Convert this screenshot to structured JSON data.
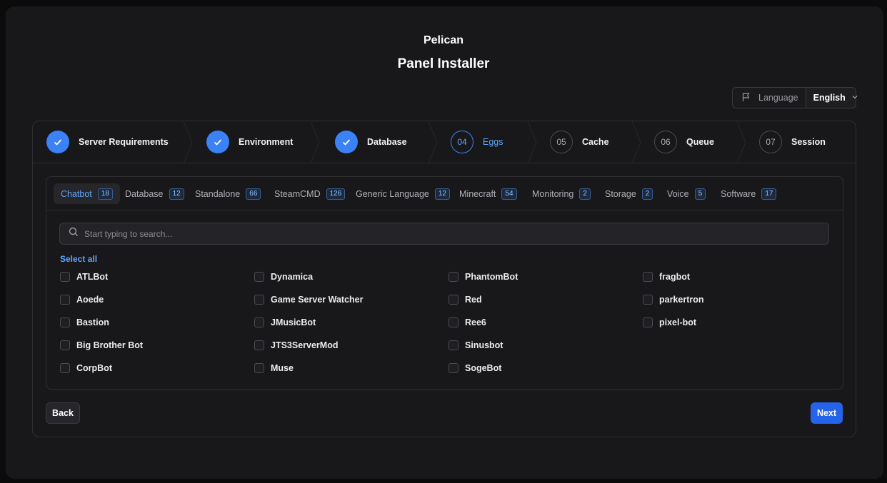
{
  "app": {
    "name": "Pelican",
    "subtitle": "Panel Installer"
  },
  "language": {
    "label": "Language",
    "value": "English"
  },
  "steps": [
    {
      "num": "01",
      "label": "Server Requirements",
      "status": "done"
    },
    {
      "num": "02",
      "label": "Environment",
      "status": "done"
    },
    {
      "num": "03",
      "label": "Database",
      "status": "done"
    },
    {
      "num": "04",
      "label": "Eggs",
      "status": "active"
    },
    {
      "num": "05",
      "label": "Cache",
      "status": "todo"
    },
    {
      "num": "06",
      "label": "Queue",
      "status": "todo"
    },
    {
      "num": "07",
      "label": "Session",
      "status": "todo"
    }
  ],
  "tabs": [
    {
      "label": "Chatbot",
      "count": "18",
      "active": true
    },
    {
      "label": "Database",
      "count": "12"
    },
    {
      "label": "Standalone",
      "count": "66"
    },
    {
      "label": "SteamCMD",
      "count": "126"
    },
    {
      "label": "Generic Language",
      "count": "12"
    },
    {
      "label": "Minecraft",
      "count": "54"
    },
    {
      "label": "Monitoring",
      "count": "2"
    },
    {
      "label": "Storage",
      "count": "2"
    },
    {
      "label": "Voice",
      "count": "5"
    },
    {
      "label": "Software",
      "count": "17"
    }
  ],
  "search": {
    "placeholder": "Start typing to search..."
  },
  "select_all": "Select all",
  "options": [
    [
      "ATLBot",
      "Aoede",
      "Bastion",
      "Big Brother Bot",
      "CorpBot"
    ],
    [
      "Dynamica",
      "Game Server Watcher",
      "JMusicBot",
      "JTS3ServerMod",
      "Muse"
    ],
    [
      "PhantomBot",
      "Red",
      "Ree6",
      "Sinusbot",
      "SogeBot"
    ],
    [
      "fragbot",
      "parkertron",
      "pixel-bot"
    ]
  ],
  "buttons": {
    "back": "Back",
    "next": "Next"
  },
  "colors": {
    "accent": "#3b82f6",
    "primary_button": "#2563eb",
    "background": "#18181b"
  }
}
